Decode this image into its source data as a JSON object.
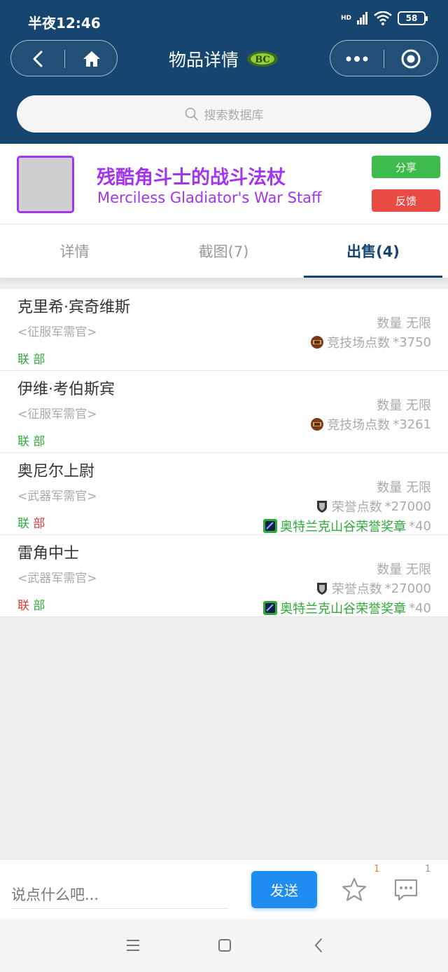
{
  "status": {
    "time": "半夜12:46",
    "network": "HD",
    "battery": "58"
  },
  "header": {
    "title": "物品详情",
    "search_placeholder": "搜索数据库"
  },
  "item": {
    "name_cn": "残酷角斗士的战斗法杖",
    "name_en": "Merciless Gladiator's War Staff",
    "share_label": "分享",
    "report_label": "反馈"
  },
  "tabs": [
    {
      "label": "详情"
    },
    {
      "label": "截图(7)"
    },
    {
      "label": "出售(4)"
    }
  ],
  "vendors": [
    {
      "name": "克里希·宾奇维斯",
      "role": "<征服军需官>",
      "faction_a": "联",
      "faction_h": "部",
      "quantity": "数量 无限",
      "costs": [
        {
          "icon": "arena-points-icon",
          "label": "竞技场点数",
          "amount": "*3750"
        }
      ]
    },
    {
      "name": "伊维·考伯斯宾",
      "role": "<征服军需官>",
      "faction_a": "联",
      "faction_h": "部",
      "quantity": "数量 无限",
      "costs": [
        {
          "icon": "arena-points-icon",
          "label": "竞技场点数",
          "amount": "*3261"
        }
      ]
    },
    {
      "name": "奥尼尔上尉",
      "role": "<武器军需官>",
      "faction_a": "联",
      "faction_h": "部",
      "quantity": "数量 无限",
      "costs": [
        {
          "icon": "honor-points-icon",
          "label": "荣誉点数",
          "amount": "*27000"
        },
        {
          "icon": "alterac-mark-icon",
          "label": "奥特兰克山谷荣誉奖章",
          "amount": "*40"
        }
      ]
    },
    {
      "name": "雷角中士",
      "role": "<武器军需官>",
      "faction_a": "联",
      "faction_h": "部",
      "quantity": "数量 无限",
      "costs": [
        {
          "icon": "honor-points-icon",
          "label": "荣誉点数",
          "amount": "*27000"
        },
        {
          "icon": "alterac-mark-icon",
          "label": "奥特兰克山谷荣誉奖章",
          "amount": "*40"
        }
      ]
    }
  ],
  "bottom": {
    "comment_placeholder": "说点什么吧...",
    "send_label": "发送",
    "star_count": "1",
    "comment_count": "1"
  },
  "colors": {
    "header_bg": "#16466f",
    "epic": "#a335ee",
    "alliance": "#2fa93a",
    "horde": "#d83a35",
    "send": "#1e8cf0"
  }
}
